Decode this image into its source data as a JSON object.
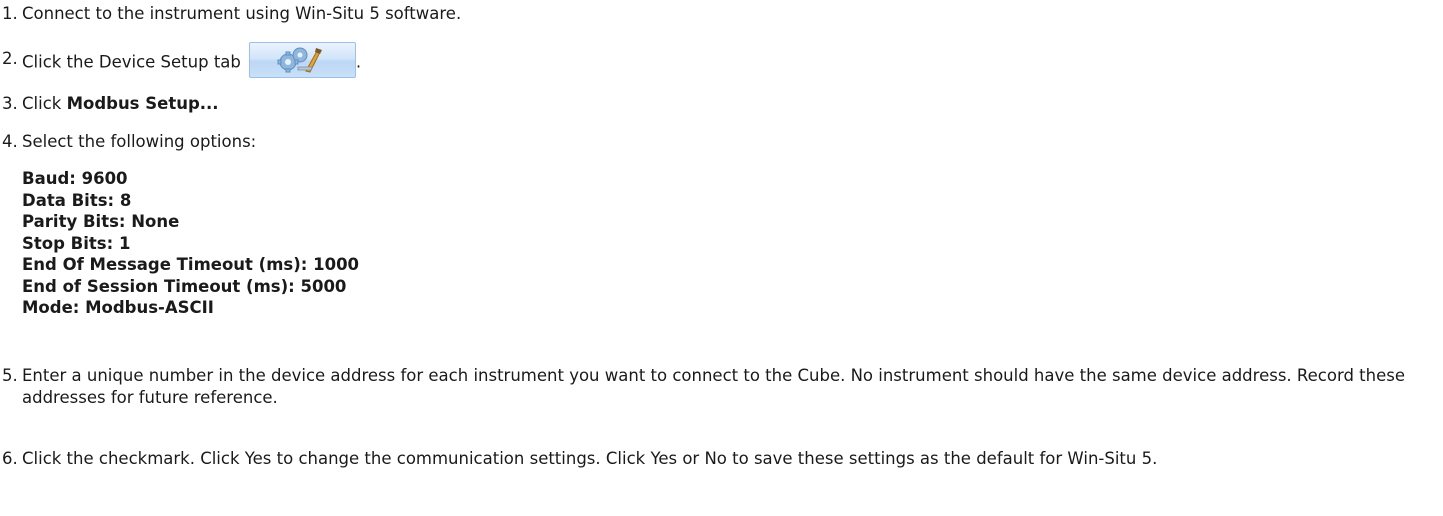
{
  "steps": [
    {
      "num": "1.",
      "text": "Connect to the instrument using Win-Situ 5 software."
    },
    {
      "num": "2.",
      "text_before": "Click the Device Setup tab",
      "text_after": "."
    },
    {
      "num": "3.",
      "text_before": "Click ",
      "bold": "Modbus Setup..."
    },
    {
      "num": "4.",
      "text": "Select the following options:"
    },
    {
      "num": "5.",
      "text": "Enter a unique number in the device address for each instrument you want to connect to the Cube. No instrument should have the same device address. Record these addresses for future reference."
    },
    {
      "num": "6.",
      "text": "Click the checkmark. Click Yes to change the communication settings. Click Yes or No to save these settings as the default for Win-Situ 5."
    }
  ],
  "device_setup_tab_icon": "device-setup-gear-icon",
  "options": [
    "Baud: 9600",
    "Data Bits: 8",
    "Parity Bits: None",
    "Stop Bits: 1",
    "End Of Message Timeout (ms): 1000",
    "End of Session Timeout (ms): 5000",
    "Mode: Modbus-ASCII"
  ],
  "colors": {
    "text": "#1a1a1a",
    "tab_background": "#c9e0f8",
    "tab_border": "#9cc0e8"
  }
}
